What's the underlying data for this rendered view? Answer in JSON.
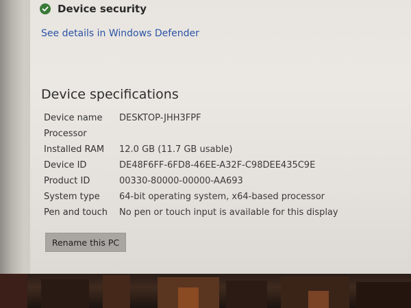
{
  "device_security": {
    "label": "Device security"
  },
  "link_text": "See details in Windows Defender",
  "specifications": {
    "heading": "Device specifications",
    "rows": [
      {
        "label": "Device name",
        "value": "DESKTOP-JHH3FPF"
      },
      {
        "label": "Processor",
        "value": ""
      },
      {
        "label": "Installed RAM",
        "value": "12.0 GB (11.7 GB usable)"
      },
      {
        "label": "Device ID",
        "value": "DE48F6FF-6FD8-46EE-A32F-C98DEE435C9E"
      },
      {
        "label": "Product ID",
        "value": "00330-80000-00000-AA693"
      },
      {
        "label": "System type",
        "value": "64-bit operating system, x64-based processor"
      },
      {
        "label": "Pen and touch",
        "value": "No pen or touch input is available for this display"
      }
    ]
  },
  "rename_button": "Rename this PC",
  "colors": {
    "link": "#2c54a6",
    "status_ok": "#3a7a38",
    "button_bg": "#a9a6a2"
  }
}
